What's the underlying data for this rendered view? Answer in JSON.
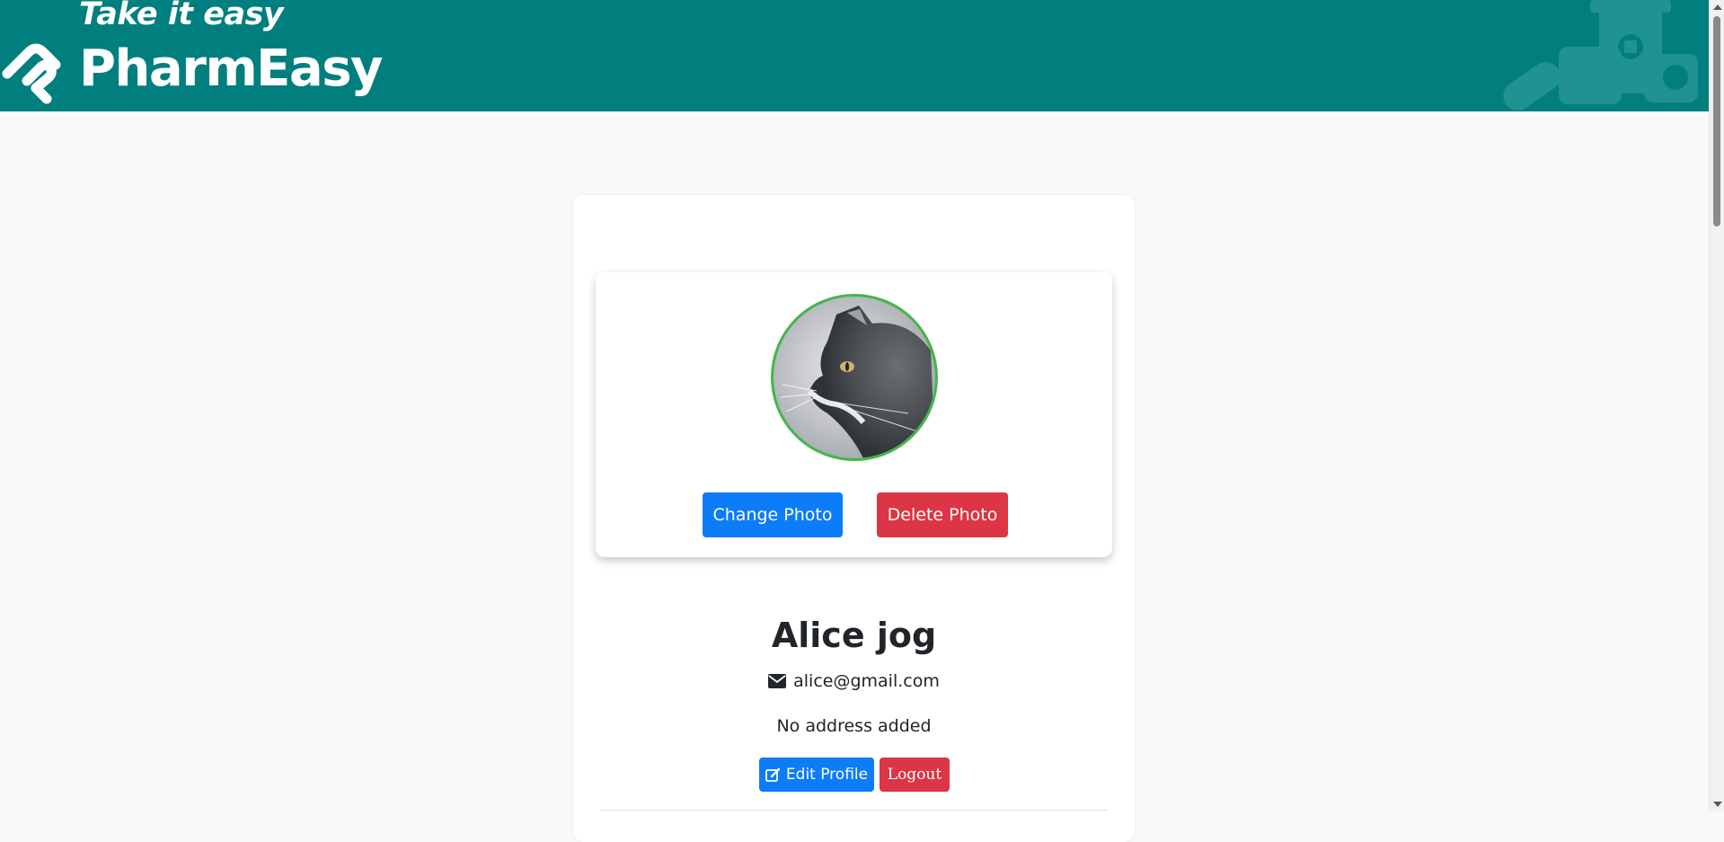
{
  "header": {
    "tagline": "Take it easy",
    "brand_name": "PharmEasy",
    "background_color": "#017f7f",
    "logo_icon": "pharmeasy-logo-icon"
  },
  "profile": {
    "photo_icon": "cat-profile-photo",
    "change_photo_label": "Change Photo",
    "delete_photo_label": "Delete Photo",
    "name": "Alice jog",
    "email": "alice@gmail.com",
    "email_icon": "envelope-icon",
    "address": "No address added",
    "edit_profile_label": "Edit Profile",
    "edit_icon": "edit-icon",
    "logout_label": "Logout"
  },
  "colors": {
    "primary": "#0d7cf8",
    "danger": "#dc3545",
    "avatar_border": "#45b649"
  }
}
